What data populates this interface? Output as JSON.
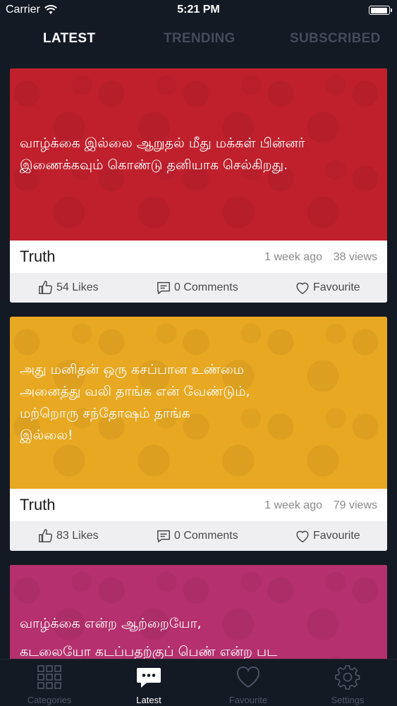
{
  "status": {
    "carrier": "Carrier",
    "time": "5:21 PM",
    "battery_level": 0.92
  },
  "top_tabs": [
    {
      "label": "LATEST",
      "active": true
    },
    {
      "label": "TRENDING",
      "active": false
    },
    {
      "label": "SUBSCRIBED",
      "active": false
    }
  ],
  "cards": [
    {
      "color": "#c0202c",
      "lines": [
        "வாழ்க்கை இல்லை ஆறுதல் மீது மக்கள் பின்னர்",
        "இணைக்கவும் கொண்டு தனியாக செல்கிறது."
      ],
      "category": "Truth",
      "time": "1 week ago",
      "views": "38 views",
      "likes": "54 Likes",
      "comments": "0 Comments",
      "favourite": "Favourite"
    },
    {
      "color": "#e8a821",
      "lines": [
        "அது மனிதன் ஒரு கசப்பான உண்மை",
        "அனைத்து வலி தாங்க என் வேண்டும்,",
        "மற்றொரு சந்தோஷம் தாங்க",
        "இல்லை!"
      ],
      "category": "Truth",
      "time": "1 week ago",
      "views": "79 views",
      "likes": "83 Likes",
      "comments": "0 Comments",
      "favourite": "Favourite"
    },
    {
      "color": "#b5306e",
      "lines": [
        "வாழ்க்கை என்ற ஆற்றையோ,",
        "கடலையோ கடப்பதற்குப் பெண் என்ற பட"
      ]
    }
  ],
  "bottom_tabs": [
    {
      "label": "Categories",
      "icon": "grid-icon",
      "active": false
    },
    {
      "label": "Latest",
      "icon": "chat-icon",
      "active": true
    },
    {
      "label": "Favourite",
      "icon": "heart-icon",
      "active": false
    },
    {
      "label": "Settings",
      "icon": "gear-icon",
      "active": false
    }
  ]
}
